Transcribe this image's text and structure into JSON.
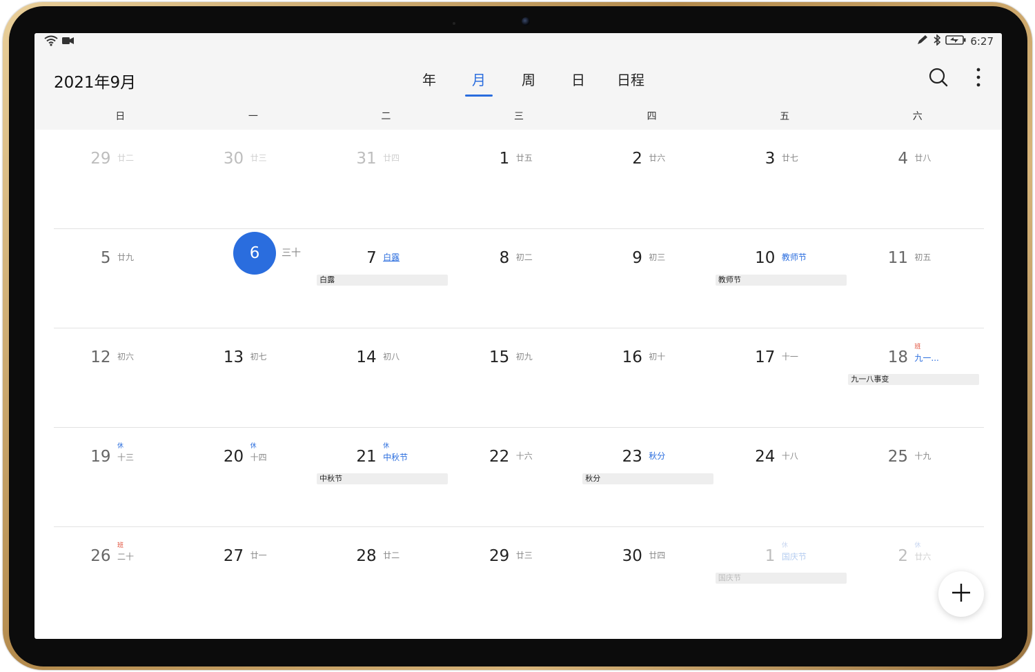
{
  "status": {
    "time": "6:27"
  },
  "header": {
    "title": "2021年9月",
    "tabs": [
      {
        "label": "年",
        "active": false
      },
      {
        "label": "月",
        "active": true
      },
      {
        "label": "周",
        "active": false
      },
      {
        "label": "日",
        "active": false
      },
      {
        "label": "日程",
        "active": false
      }
    ],
    "icons": [
      "search-icon",
      "more-vert-icon"
    ]
  },
  "weekdays": [
    "日",
    "一",
    "二",
    "三",
    "四",
    "五",
    "六"
  ],
  "weeks": [
    [
      {
        "day": "29",
        "lunar": "廿二",
        "dim": true
      },
      {
        "day": "30",
        "lunar": "廿三",
        "dim": true
      },
      {
        "day": "31",
        "lunar": "廿四",
        "dim": true
      },
      {
        "day": "1",
        "lunar": "廿五"
      },
      {
        "day": "2",
        "lunar": "廿六"
      },
      {
        "day": "3",
        "lunar": "廿七"
      },
      {
        "day": "4",
        "lunar": "廿八"
      }
    ],
    [
      {
        "day": "5",
        "lunar": "廿九"
      },
      {
        "day": "6",
        "lunar": "三十",
        "today": true
      },
      {
        "day": "7",
        "lunar": "白露",
        "festival": true,
        "underline": true,
        "event": "白露"
      },
      {
        "day": "8",
        "lunar": "初二"
      },
      {
        "day": "9",
        "lunar": "初三"
      },
      {
        "day": "10",
        "lunar": "教师节",
        "festival": true,
        "event": "教师节"
      },
      {
        "day": "11",
        "lunar": "初五"
      }
    ],
    [
      {
        "day": "12",
        "lunar": "初六"
      },
      {
        "day": "13",
        "lunar": "初七"
      },
      {
        "day": "14",
        "lunar": "初八"
      },
      {
        "day": "15",
        "lunar": "初九"
      },
      {
        "day": "16",
        "lunar": "初十"
      },
      {
        "day": "17",
        "lunar": "十一"
      },
      {
        "day": "18",
        "lunar": "九一...",
        "festival": true,
        "badge": "班",
        "badgeType": "work",
        "event": "九一八事变"
      }
    ],
    [
      {
        "day": "19",
        "lunar": "十三",
        "badge": "休",
        "badgeType": "rest"
      },
      {
        "day": "20",
        "lunar": "十四",
        "badge": "休",
        "badgeType": "rest"
      },
      {
        "day": "21",
        "lunar": "中秋节",
        "festival": true,
        "badge": "休",
        "badgeType": "rest",
        "event": "中秋节"
      },
      {
        "day": "22",
        "lunar": "十六"
      },
      {
        "day": "23",
        "lunar": "秋分",
        "festival": true,
        "event": "秋分"
      },
      {
        "day": "24",
        "lunar": "十八"
      },
      {
        "day": "25",
        "lunar": "十九"
      }
    ],
    [
      {
        "day": "26",
        "lunar": "二十",
        "badge": "班",
        "badgeType": "work"
      },
      {
        "day": "27",
        "lunar": "廿一"
      },
      {
        "day": "28",
        "lunar": "廿二"
      },
      {
        "day": "29",
        "lunar": "廿三"
      },
      {
        "day": "30",
        "lunar": "廿四"
      },
      {
        "day": "1",
        "lunar": "国庆节",
        "festival": true,
        "dim": true,
        "badge": "休",
        "badgeType": "rest",
        "event": "国庆节"
      },
      {
        "day": "2",
        "lunar": "廿六",
        "dim": true,
        "badge": "休",
        "badgeType": "rest"
      }
    ]
  ],
  "fab": {
    "icon": "plus-icon"
  },
  "colors": {
    "accent": "#2a6dde",
    "work": "#e04b35"
  }
}
